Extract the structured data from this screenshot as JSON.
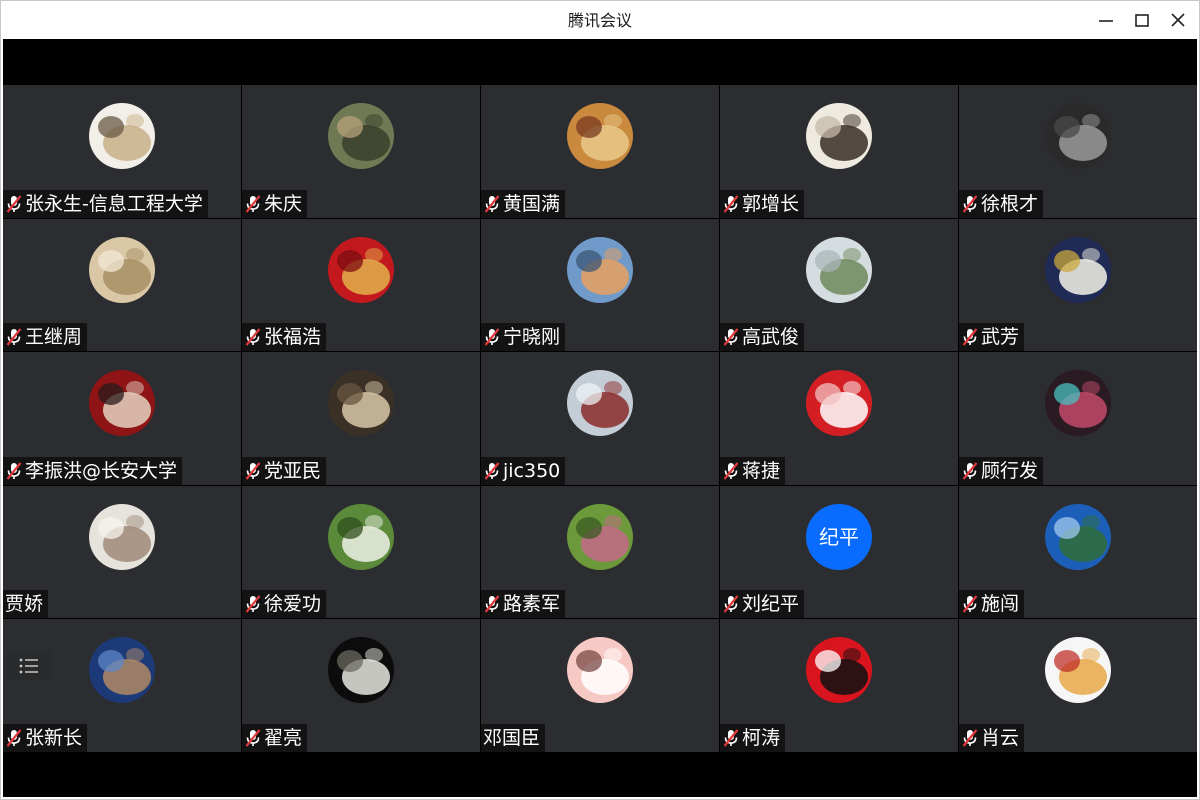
{
  "window": {
    "title": "腾讯会议"
  },
  "controls": {
    "minimize_icon": "minimize-icon",
    "maximize_icon": "maximize-icon",
    "close_icon": "close-icon"
  },
  "colors": {
    "tile_bg": "#2b2d30",
    "stage_bg": "#000000",
    "mic_muted_red": "#e0393e",
    "text_avatar_blue": "#0a6cff"
  },
  "participants": [
    {
      "name": "张永生-信息工程大学",
      "muted": true,
      "avatar": "photo",
      "palette": [
        "#f2efe8",
        "#c9b08a",
        "#6b5a46"
      ]
    },
    {
      "name": "朱庆",
      "muted": true,
      "avatar": "photo",
      "palette": [
        "#6f7a55",
        "#3a3e2a",
        "#b7a27a"
      ]
    },
    {
      "name": "黄国满",
      "muted": true,
      "avatar": "photo",
      "palette": [
        "#c98a3e",
        "#e9c88a",
        "#7a3a20"
      ]
    },
    {
      "name": "郭增长",
      "muted": true,
      "avatar": "photo",
      "palette": [
        "#efeae0",
        "#3a2e24",
        "#c4baa8"
      ]
    },
    {
      "name": "徐根才",
      "muted": true,
      "avatar": "photo",
      "palette": [
        "#2a2a2a",
        "#9a9a9a",
        "#4a4a4a"
      ]
    },
    {
      "name": "王继周",
      "muted": true,
      "avatar": "photo",
      "palette": [
        "#d9c7a6",
        "#a88f64",
        "#f1e8d6"
      ]
    },
    {
      "name": "张福浩",
      "muted": true,
      "avatar": "photo",
      "palette": [
        "#c4181f",
        "#e2b04a",
        "#7e0d12"
      ]
    },
    {
      "name": "宁晓刚",
      "muted": true,
      "avatar": "photo",
      "palette": [
        "#6f9ac9",
        "#e8a060",
        "#3b5575"
      ]
    },
    {
      "name": "高武俊",
      "muted": true,
      "avatar": "photo",
      "palette": [
        "#d6dde0",
        "#6f8a5a",
        "#a9b6b9"
      ]
    },
    {
      "name": "武芳",
      "muted": true,
      "avatar": "photo",
      "palette": [
        "#1f2a55",
        "#f4f3ea",
        "#c9a83c"
      ]
    },
    {
      "name": "李振洪@长安大学",
      "muted": true,
      "avatar": "photo",
      "palette": [
        "#8e1416",
        "#e4d2c2",
        "#2a1a1a"
      ]
    },
    {
      "name": "党亚民",
      "muted": true,
      "avatar": "photo",
      "palette": [
        "#3a3026",
        "#d8c7a8",
        "#6a5640"
      ]
    },
    {
      "name": "jic350",
      "muted": true,
      "avatar": "photo",
      "palette": [
        "#c4cdd6",
        "#8c2a2a",
        "#eef1f3"
      ]
    },
    {
      "name": "蒋捷",
      "muted": true,
      "avatar": "photo",
      "palette": [
        "#d31f24",
        "#ffffff",
        "#f0c0c0"
      ]
    },
    {
      "name": "顾行发",
      "muted": true,
      "avatar": "photo",
      "palette": [
        "#2a1a22",
        "#c24a6a",
        "#4ac0c0"
      ]
    },
    {
      "name": "贾娇",
      "muted": false,
      "avatar": "photo",
      "palette": [
        "#e6e2dc",
        "#a08a78",
        "#f6f4f0"
      ]
    },
    {
      "name": "徐爱功",
      "muted": true,
      "avatar": "photo",
      "palette": [
        "#5a8a3a",
        "#eef0e6",
        "#2f4f1e"
      ]
    },
    {
      "name": "路素军",
      "muted": true,
      "avatar": "photo",
      "palette": [
        "#6c9a3a",
        "#c46a8a",
        "#3a5a22"
      ]
    },
    {
      "name": "刘纪平",
      "muted": true,
      "avatar": "text",
      "avatar_text": "纪平",
      "palette": [
        "#0a6cff"
      ]
    },
    {
      "name": "施闯",
      "muted": true,
      "avatar": "photo",
      "palette": [
        "#1c5fb8",
        "#2f6f3a",
        "#9fc7ee"
      ]
    },
    {
      "name": "张新长",
      "muted": true,
      "avatar": "photo",
      "palette": [
        "#1d3a78",
        "#b08a66",
        "#5c86c8"
      ]
    },
    {
      "name": "翟亮",
      "muted": true,
      "avatar": "photo",
      "palette": [
        "#0c0c0c",
        "#e8e8e0",
        "#6a6a60"
      ]
    },
    {
      "name": "邓国臣",
      "muted": false,
      "avatar": "photo",
      "palette": [
        "#f7c9c4",
        "#ffffff",
        "#7a4a44"
      ]
    },
    {
      "name": "柯涛",
      "muted": true,
      "avatar": "photo",
      "palette": [
        "#d8141e",
        "#111111",
        "#ffffff"
      ]
    },
    {
      "name": "肖云",
      "muted": true,
      "avatar": "photo",
      "palette": [
        "#f6f6f6",
        "#e8a848",
        "#c2302a"
      ]
    }
  ],
  "participants_list_icon": "list-icon"
}
